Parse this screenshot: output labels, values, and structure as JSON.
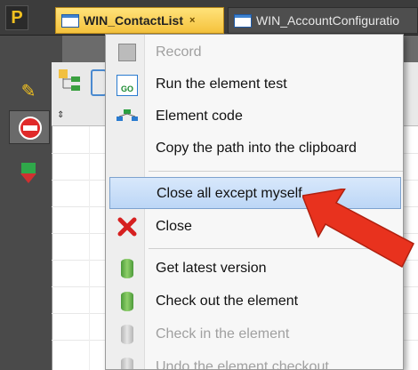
{
  "app": {
    "logo_letter": "P"
  },
  "tabs": [
    {
      "label": "WIN_ContactList",
      "close_glyph": "×",
      "active": true
    },
    {
      "label": "WIN_AccountConfiguratio",
      "active": false
    }
  ],
  "panel": {
    "sort_indicator": "⇕"
  },
  "context_menu": {
    "items": [
      {
        "label": "Record",
        "icon": "floppy-icon",
        "disabled": true
      },
      {
        "label": "Run the element test",
        "icon": "run-test-icon",
        "disabled": false
      },
      {
        "label": "Element code",
        "icon": "element-code-icon",
        "disabled": false
      },
      {
        "label": "Copy the path into the clipboard",
        "icon": "",
        "disabled": false
      },
      {
        "label": "Close all except myself",
        "icon": "",
        "disabled": false,
        "highlighted": true
      },
      {
        "label": "Close",
        "icon": "close-x-icon",
        "disabled": false
      },
      {
        "label": "Get latest version",
        "icon": "get-latest-icon",
        "disabled": false
      },
      {
        "label": "Check out the element",
        "icon": "check-out-icon",
        "disabled": false
      },
      {
        "label": "Check in the element",
        "icon": "check-in-icon",
        "disabled": true
      },
      {
        "label": "Undo the element checkout",
        "icon": "undo-checkout-icon",
        "disabled": true
      }
    ]
  },
  "colors": {
    "highlight": "#bcd6f6",
    "arrow": "#e8321e",
    "active_tab": "#f5c23c"
  }
}
